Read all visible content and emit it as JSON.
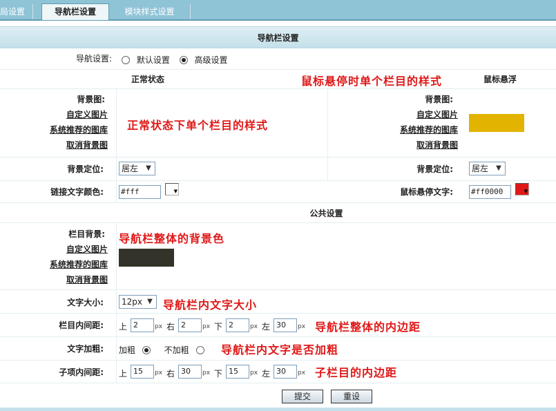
{
  "tabs": [
    {
      "label": "局设置"
    },
    {
      "label": "导航栏设置"
    },
    {
      "label": "模块样式设置"
    }
  ],
  "header": {
    "title": "导航栏设置"
  },
  "nav_mode": {
    "label": "导航设置:",
    "option_default": "默认设置",
    "option_advanced": "高级设置",
    "selected": "高级设置"
  },
  "normal_state": {
    "title": "正常状态",
    "bg_label": "背景图:",
    "links": [
      "自定义图片",
      "系统推荐的图库",
      "取消背景图"
    ],
    "position_label": "背景定位:",
    "position_value": "居左",
    "link_color_label": "链接文字颜色:",
    "link_color_value": "#fff"
  },
  "hover_state": {
    "title": "鼠标悬浮",
    "bg_label": "背景图:",
    "links": [
      "自定义图片",
      "系统推荐的图库",
      "取消背景图"
    ],
    "bg_color": "#e2b300",
    "position_label": "背景定位:",
    "position_value": "居左",
    "text_color_label": "鼠标悬停文字:",
    "text_color_value": "#ff0000"
  },
  "public": {
    "title": "公共设置",
    "bg_label": "栏目背景:",
    "links": [
      "自定义图片",
      "系统推荐的图库",
      "取消背景图"
    ],
    "bg_color": "#333329",
    "font_size_label": "文字大小:",
    "font_size_value": "12px",
    "padding_label": "栏目内间距:",
    "padding": {
      "top": "2",
      "right": "2",
      "bottom": "2",
      "left": "30"
    },
    "bold_label": "文字加粗:",
    "bold_on": "加粗",
    "bold_off": "不加粗",
    "bold_selected": "加粗",
    "item_padding_label": "子项内间距:",
    "item_padding": {
      "top": "15",
      "right": "30",
      "bottom": "15",
      "left": "30"
    }
  },
  "dir_labels": {
    "top": "上",
    "right": "右",
    "bottom": "下",
    "left": "左",
    "unit": "px"
  },
  "annotations": {
    "hover_item_style": "鼠标悬停时单个栏目的样式",
    "normal_item_style": "正常状态下单个栏目的样式",
    "bar_bg": "导航栏整体的背景色",
    "font_size": "导航栏内文字大小",
    "bar_padding": "导航栏整体的内边距",
    "bold": "导航栏内文字是否加粗",
    "item_padding": "子栏目的内边距"
  },
  "buttons": {
    "submit": "提交",
    "reset": "重设"
  }
}
